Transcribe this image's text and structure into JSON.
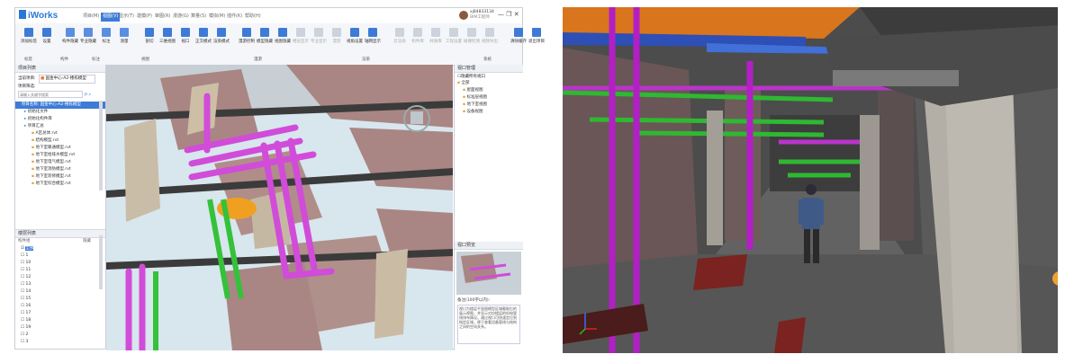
{
  "left_app": {
    "title": "iWorks",
    "tabs": [
      {
        "label": "项目(M)",
        "active": false
      },
      {
        "label": "视图(V)",
        "active": true
      },
      {
        "label": "显示(T)",
        "active": false
      },
      {
        "label": "建模(P)",
        "active": false
      },
      {
        "label": "审图(R)",
        "active": false
      },
      {
        "label": "漫游(G)",
        "active": false
      },
      {
        "label": "算量(S)",
        "active": false
      },
      {
        "label": "模拟(M)",
        "active": false
      },
      {
        "label": "插件(K)",
        "active": false
      },
      {
        "label": "帮助(H)",
        "active": false
      }
    ],
    "user": {
      "name": "xj84833134",
      "role": "BIM工程师"
    },
    "window_controls": "—  ❐  ✕",
    "ribbon": {
      "buttons": [
        {
          "label": "添加标签",
          "icon": "tag-icon",
          "color": "#3e7bd6",
          "dim": false
        },
        {
          "label": "设置",
          "icon": "settings-icon",
          "color": "#3e7bd6",
          "dim": false
        },
        {
          "label": "构件隐藏",
          "icon": "hide-icon",
          "color": "#5a8fe0",
          "dim": false
        },
        {
          "label": "专业隐藏",
          "icon": "layers-icon",
          "color": "#5a8fe0",
          "dim": false
        },
        {
          "label": "标注",
          "icon": "annotate-icon",
          "color": "#5a8fe0",
          "dim": false
        },
        {
          "label": "测量",
          "icon": "measure-icon",
          "color": "#5a8fe0",
          "dim": false
        },
        {
          "label": "剖切",
          "icon": "section-icon",
          "color": "#3e7bd6",
          "dim": false
        },
        {
          "label": "三维视图",
          "icon": "cube-icon",
          "color": "#3e7bd6",
          "dim": false
        },
        {
          "label": "视口",
          "icon": "viewport-icon",
          "color": "#3e7bd6",
          "dim": false
        },
        {
          "label": "正交模式",
          "icon": "ortho-icon",
          "color": "#3e7bd6",
          "dim": false
        },
        {
          "label": "渲染模式",
          "icon": "render-icon",
          "color": "#3e7bd6",
          "dim": false
        },
        {
          "label": "漫游控制",
          "icon": "walk-icon",
          "color": "#3e7bd6",
          "dim": false
        },
        {
          "label": "模型隐藏",
          "icon": "model-hide-icon",
          "color": "#3e7bd6",
          "dim": false
        },
        {
          "label": "视图隐藏",
          "icon": "view-hide-icon",
          "color": "#3e7bd6",
          "dim": false
        },
        {
          "label": "楼层显示",
          "icon": "floor-icon",
          "color": "#3e7bd6",
          "dim": true
        },
        {
          "label": "专业显示",
          "icon": "discipline-icon",
          "color": "#3e7bd6",
          "dim": true
        },
        {
          "label": "漫游",
          "icon": "tour-icon",
          "color": "#3e7bd6",
          "dim": true
        },
        {
          "label": "视角设置",
          "icon": "camera-icon",
          "color": "#3e7bd6",
          "dim": false
        },
        {
          "label": "轴网显示",
          "icon": "grid-icon",
          "color": "#3e7bd6",
          "dim": false
        },
        {
          "label": "云渲染",
          "icon": "cloud-icon",
          "color": "#3e7bd6",
          "dim": true
        },
        {
          "label": "构件库",
          "icon": "library-icon",
          "color": "#3e7bd6",
          "dim": true
        },
        {
          "label": "材质库",
          "icon": "material-icon",
          "color": "#3e7bd6",
          "dim": true
        },
        {
          "label": "工程设置",
          "icon": "project-icon",
          "color": "#3e7bd6",
          "dim": true
        },
        {
          "label": "碰撞检测",
          "icon": "clash-icon",
          "color": "#3e7bd6",
          "dim": true
        },
        {
          "label": "视频导出",
          "icon": "video-icon",
          "color": "#3e7bd6",
          "dim": true
        },
        {
          "label": "清除缓存",
          "icon": "clear-icon",
          "color": "#3e7bd6",
          "dim": false
        },
        {
          "label": "退出项目",
          "icon": "exit-icon",
          "color": "#3e7bd6",
          "dim": false
        }
      ],
      "groups": [
        "标签",
        "构件",
        "标注",
        "视图",
        "漫游",
        "渲染",
        "系统"
      ]
    },
    "left_panel": {
      "title": "项目列表",
      "current_project_label": "当前项目:",
      "current_project_value": "国金中心-A2-楼栋模型",
      "filter_label": "项目筛选:",
      "search_placeholder": "请输入关键字搜索",
      "tree": [
        {
          "label": "项目名称: 国金中心-A2-楼栋模型",
          "selected": true
        },
        {
          "label": "初始化文件",
          "selected": false
        },
        {
          "label": "初始化构件库",
          "selected": false
        },
        {
          "label": "项目汇总",
          "selected": false
        },
        {
          "label": "A区总体.rvt",
          "selected": false
        },
        {
          "label": "结构模型.rvt",
          "selected": false
        },
        {
          "label": "地下室暖通模型.rvt",
          "selected": false
        },
        {
          "label": "地下室给排水模型.rvt",
          "selected": false
        },
        {
          "label": "地下室电气模型.rvt",
          "selected": false
        },
        {
          "label": "地下室消防模型.rvt",
          "selected": false
        },
        {
          "label": "地下室装修模型.rvt",
          "selected": false
        },
        {
          "label": "地下室综合模型.rvt",
          "selected": false
        }
      ],
      "layer_panel_title": "楼层列表",
      "layer_header": "构件组",
      "layer_header_right": "隐藏",
      "layers": [
        "全部",
        "1",
        "10",
        "11",
        "12",
        "13",
        "14",
        "15",
        "16",
        "17",
        "18",
        "19",
        "2",
        "3"
      ]
    },
    "right_panel": {
      "title": "视口管理",
      "checkbox_label": "隐藏所有视口",
      "tree": [
        "全部",
        "屋面视图",
        "标准层视图",
        "地下室视图",
        "设备视图"
      ],
      "preview_title": "视口预览",
      "info_title": "备注(100字以内):",
      "info_text": "视口为楼层平面图模型区域截取后的展示视图，并显示对应楼层的机电管线排布情况。通过视口可快速定位到指定区域，便于查看设备管线与结构之间的空间关系。"
    }
  },
  "right_view": {
    "axis_label": "Z"
  }
}
